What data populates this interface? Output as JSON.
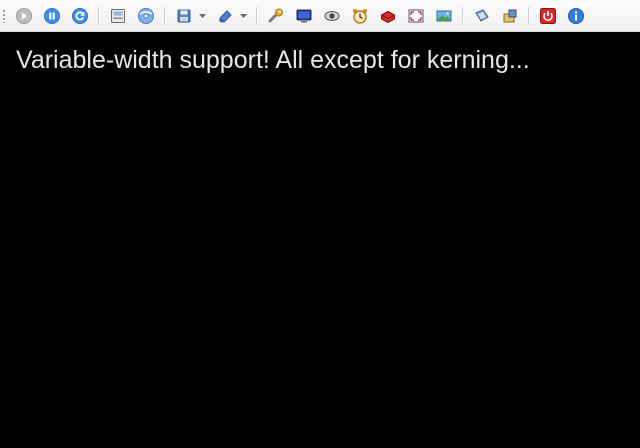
{
  "screen": {
    "background_color": "#000000",
    "text_color": "#e6e6e6",
    "message": "Variable-width support! All except for kerning..."
  },
  "toolbar": {
    "background_color": "#f4f4f4",
    "groups": [
      {
        "icons": [
          "play-icon",
          "pause-icon",
          "reset-icon"
        ]
      },
      {
        "icons": [
          "memory-card-icon",
          "disc-icon"
        ]
      },
      {
        "icons": [
          "save-state-icon",
          "load-state-icon"
        ]
      },
      {
        "icons": [
          "wrench-icon",
          "display-icon",
          "eye-icon",
          "alarm-clock-icon",
          "cheat-icon",
          "fullscreen-icon",
          "screenshot-icon"
        ]
      },
      {
        "icons": [
          "network-icon",
          "plugin-icon"
        ]
      },
      {
        "icons": [
          "power-icon",
          "info-icon"
        ]
      }
    ]
  }
}
